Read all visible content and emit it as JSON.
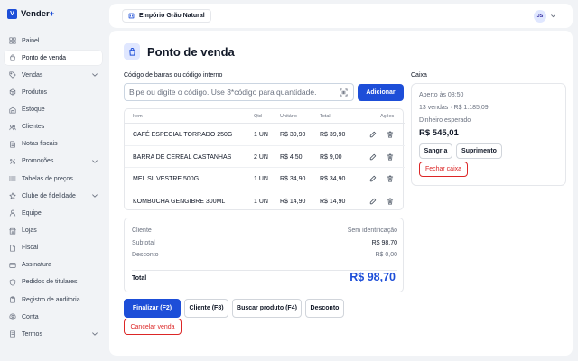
{
  "app": {
    "name": "Vender",
    "name_suffix": "+",
    "logo_glyph": "V"
  },
  "sidebar": {
    "items": [
      {
        "label": "Painel",
        "icon": "grid-icon"
      },
      {
        "label": "Ponto de venda",
        "icon": "bag-icon",
        "active": true
      },
      {
        "label": "Vendas",
        "icon": "tag-icon",
        "expandable": true
      },
      {
        "label": "Produtos",
        "icon": "box-icon"
      },
      {
        "label": "Estoque",
        "icon": "warehouse-icon"
      },
      {
        "label": "Clientes",
        "icon": "users-icon"
      },
      {
        "label": "Notas fiscais",
        "icon": "file-icon"
      },
      {
        "label": "Promoções",
        "icon": "percent-icon",
        "expandable": true
      },
      {
        "label": "Tabelas de preços",
        "icon": "list-icon"
      },
      {
        "label": "Clube de fidelidade",
        "icon": "star-icon",
        "expandable": true
      },
      {
        "label": "Equipe",
        "icon": "person-icon"
      },
      {
        "label": "Lojas",
        "icon": "store-icon"
      },
      {
        "label": "Fiscal",
        "icon": "document-icon"
      },
      {
        "label": "Assinatura",
        "icon": "card-icon"
      },
      {
        "label": "Pedidos de titulares",
        "icon": "shield-icon"
      },
      {
        "label": "Registro de auditoria",
        "icon": "clipboard-icon"
      },
      {
        "label": "Conta",
        "icon": "user-circle-icon"
      },
      {
        "label": "Termos",
        "icon": "page-icon",
        "expandable": true
      }
    ]
  },
  "topbar": {
    "store": "Empório Grão Natural",
    "user_initials": "JS"
  },
  "page": {
    "title": "Ponto de venda"
  },
  "search": {
    "label": "Código de barras ou código interno",
    "placeholder": "Bipe ou digite o código. Use 3*código para quantidade.",
    "add_button": "Adicionar"
  },
  "table": {
    "headers": {
      "item": "Item",
      "qty": "Qtd",
      "unit": "Unitário",
      "total": "Total",
      "actions": "Ações"
    },
    "rows": [
      {
        "item": "CAFÉ ESPECIAL TORRADO 250G",
        "qty": "1 UN",
        "unit": "R$ 39,90",
        "total": "R$ 39,90"
      },
      {
        "item": "BARRA DE CEREAL CASTANHAS",
        "qty": "2 UN",
        "unit": "R$ 4,50",
        "total": "R$ 9,00"
      },
      {
        "item": "MEL SILVESTRE 500G",
        "qty": "1 UN",
        "unit": "R$ 34,90",
        "total": "R$ 34,90"
      },
      {
        "item": "KOMBUCHA GENGIBRE 300ML",
        "qty": "1 UN",
        "unit": "R$ 14,90",
        "total": "R$ 14,90"
      }
    ]
  },
  "summary": {
    "client_label": "Cliente",
    "client_value": "Sem identificação",
    "subtotal_label": "Subtotal",
    "subtotal_value": "R$ 98,70",
    "discount_label": "Desconto",
    "discount_value": "R$ 0,00",
    "total_label": "Total",
    "total_value": "R$ 98,70"
  },
  "actions": {
    "finalize": "Finalizar (F2)",
    "client": "Cliente (F8)",
    "search_product": "Buscar produto (F4)",
    "discount": "Desconto",
    "cancel": "Cancelar venda"
  },
  "caixa": {
    "title": "Caixa",
    "opened": "Aberto às 08:50",
    "sales": "13 vendas · R$ 1.185,09",
    "expected_label": "Dinheiro esperado",
    "expected_value": "R$ 545,01",
    "withdraw": "Sangria",
    "supply": "Suprimento",
    "close": "Fechar caixa"
  },
  "colors": {
    "accent": "#1d4ed8",
    "danger": "#dc2626"
  }
}
